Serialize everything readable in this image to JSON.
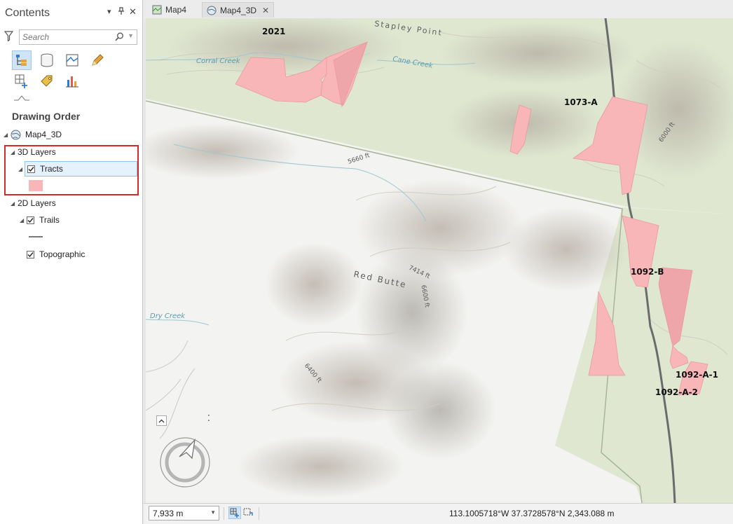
{
  "contents": {
    "title": "Contents",
    "pin_glyph": "▾",
    "dock_glyph": "⊥",
    "close_glyph": "✕",
    "search_placeholder": "Search",
    "drawing_order_label": "Drawing Order",
    "tree": {
      "map_name": "Map4_3D",
      "layers_3d": "3D Layers",
      "tracts": "Tracts",
      "layers_2d": "2D Layers",
      "trails": "Trails",
      "topographic": "Topographic"
    }
  },
  "tabs": [
    {
      "label": "Map4",
      "icon": "map-icon",
      "active": false
    },
    {
      "label": "Map4_3D",
      "icon": "globe-icon",
      "active": true,
      "close": "✕"
    }
  ],
  "map": {
    "tract_labels": [
      "2021",
      "1073-A",
      "1092-B",
      "1092-A-1",
      "1092-A-2"
    ],
    "place_labels": {
      "stapley_point": "Stapley Point",
      "corral_creek": "Corral Creek",
      "cane_creek": "Cane Creek",
      "red_butte": "Red Butte",
      "dry_creek": "Dry Creek",
      "elev_5660": "5660 ft",
      "elev_6000": "6000 ft",
      "elev_7414": "7414 ft",
      "elev_6600": "6600 ft",
      "elev_6400": "6400 ft"
    },
    "tract_color": "#f8b6b8",
    "road_color": "#6b6b6b"
  },
  "status": {
    "scale": "7,933 m",
    "coordinates": "113.1005718°W 37.3728578°N  2,343.088 m"
  }
}
